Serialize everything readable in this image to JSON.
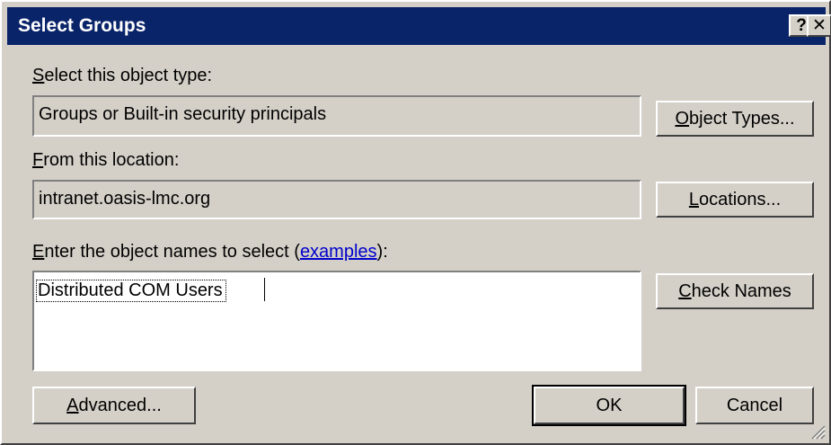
{
  "window": {
    "title": "Select Groups",
    "help_glyph": "?",
    "close_glyph": "✕"
  },
  "object_type": {
    "label_key": "S",
    "label_rest": "elect this object type:",
    "value": "Groups or Built-in security principals",
    "button_key": "O",
    "button_rest": "bject Types..."
  },
  "location": {
    "label_key": "F",
    "label_rest": "rom this location:",
    "value": "intranet.oasis-lmc.org",
    "button_key": "L",
    "button_rest": "ocations..."
  },
  "names": {
    "label_key": "E",
    "label_rest": "nter the object names to select (",
    "link": "examples",
    "label_end": "):",
    "value": "Distributed COM Users",
    "button_key": "C",
    "button_rest": "heck Names"
  },
  "footer": {
    "advanced_key": "A",
    "advanced_rest": "dvanced...",
    "ok": "OK",
    "cancel": "Cancel"
  },
  "icons": {
    "help": "help-icon",
    "close": "close-icon",
    "resize": "resize-grip-icon"
  },
  "colors": {
    "titlebar": "#0a246a",
    "face": "#d4d0c8",
    "link": "#0000cc"
  }
}
